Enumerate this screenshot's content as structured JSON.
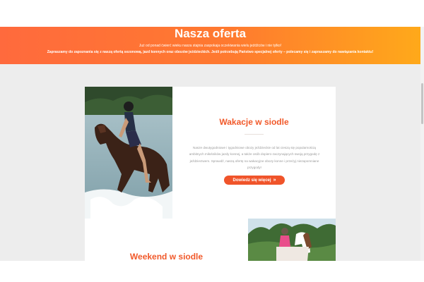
{
  "hero": {
    "title": "Nasza oferta",
    "line1": "Już od ponad ćwierć wieku nasza stajnia zaspokaja oczekiwania wielu jeźdźców i nie tylko!",
    "line2": "Zapraszamy do zapoznania się z naszą ofertą sezonową, jazd konnych oraz obozów jeździeckich. Jeśli potrzebują Państwo specjalnej oferty – polecamy się i zapraszamy do nawiązania kontaktu!"
  },
  "offers": [
    {
      "title": "Wakacje w siodle",
      "description": "Nasze dwutygodniowe i tygodniowe obozy jeździeckie od lat cieszą się popularnością ambitnych miłośników jazdy konnej, a także osób dopiero zaczynających swoją przygodę z jeździectwem. Sprawdź, naszą ofertę na wakacyjne obozy konne i przeżyj niezapomniane przygody!",
      "button_label": "Dowiedz się więcej",
      "button_icon": "double-chevron-right-icon",
      "photo": "girl-riding-horse-in-lake"
    },
    {
      "title": "Weekend w siodle",
      "photo": "girl-in-pink-on-horse"
    }
  ],
  "colors": {
    "gradient_start": "#ff6a3d",
    "gradient_end": "#ffa91a",
    "accent": "#f1592a",
    "section_bg": "#ededed"
  }
}
